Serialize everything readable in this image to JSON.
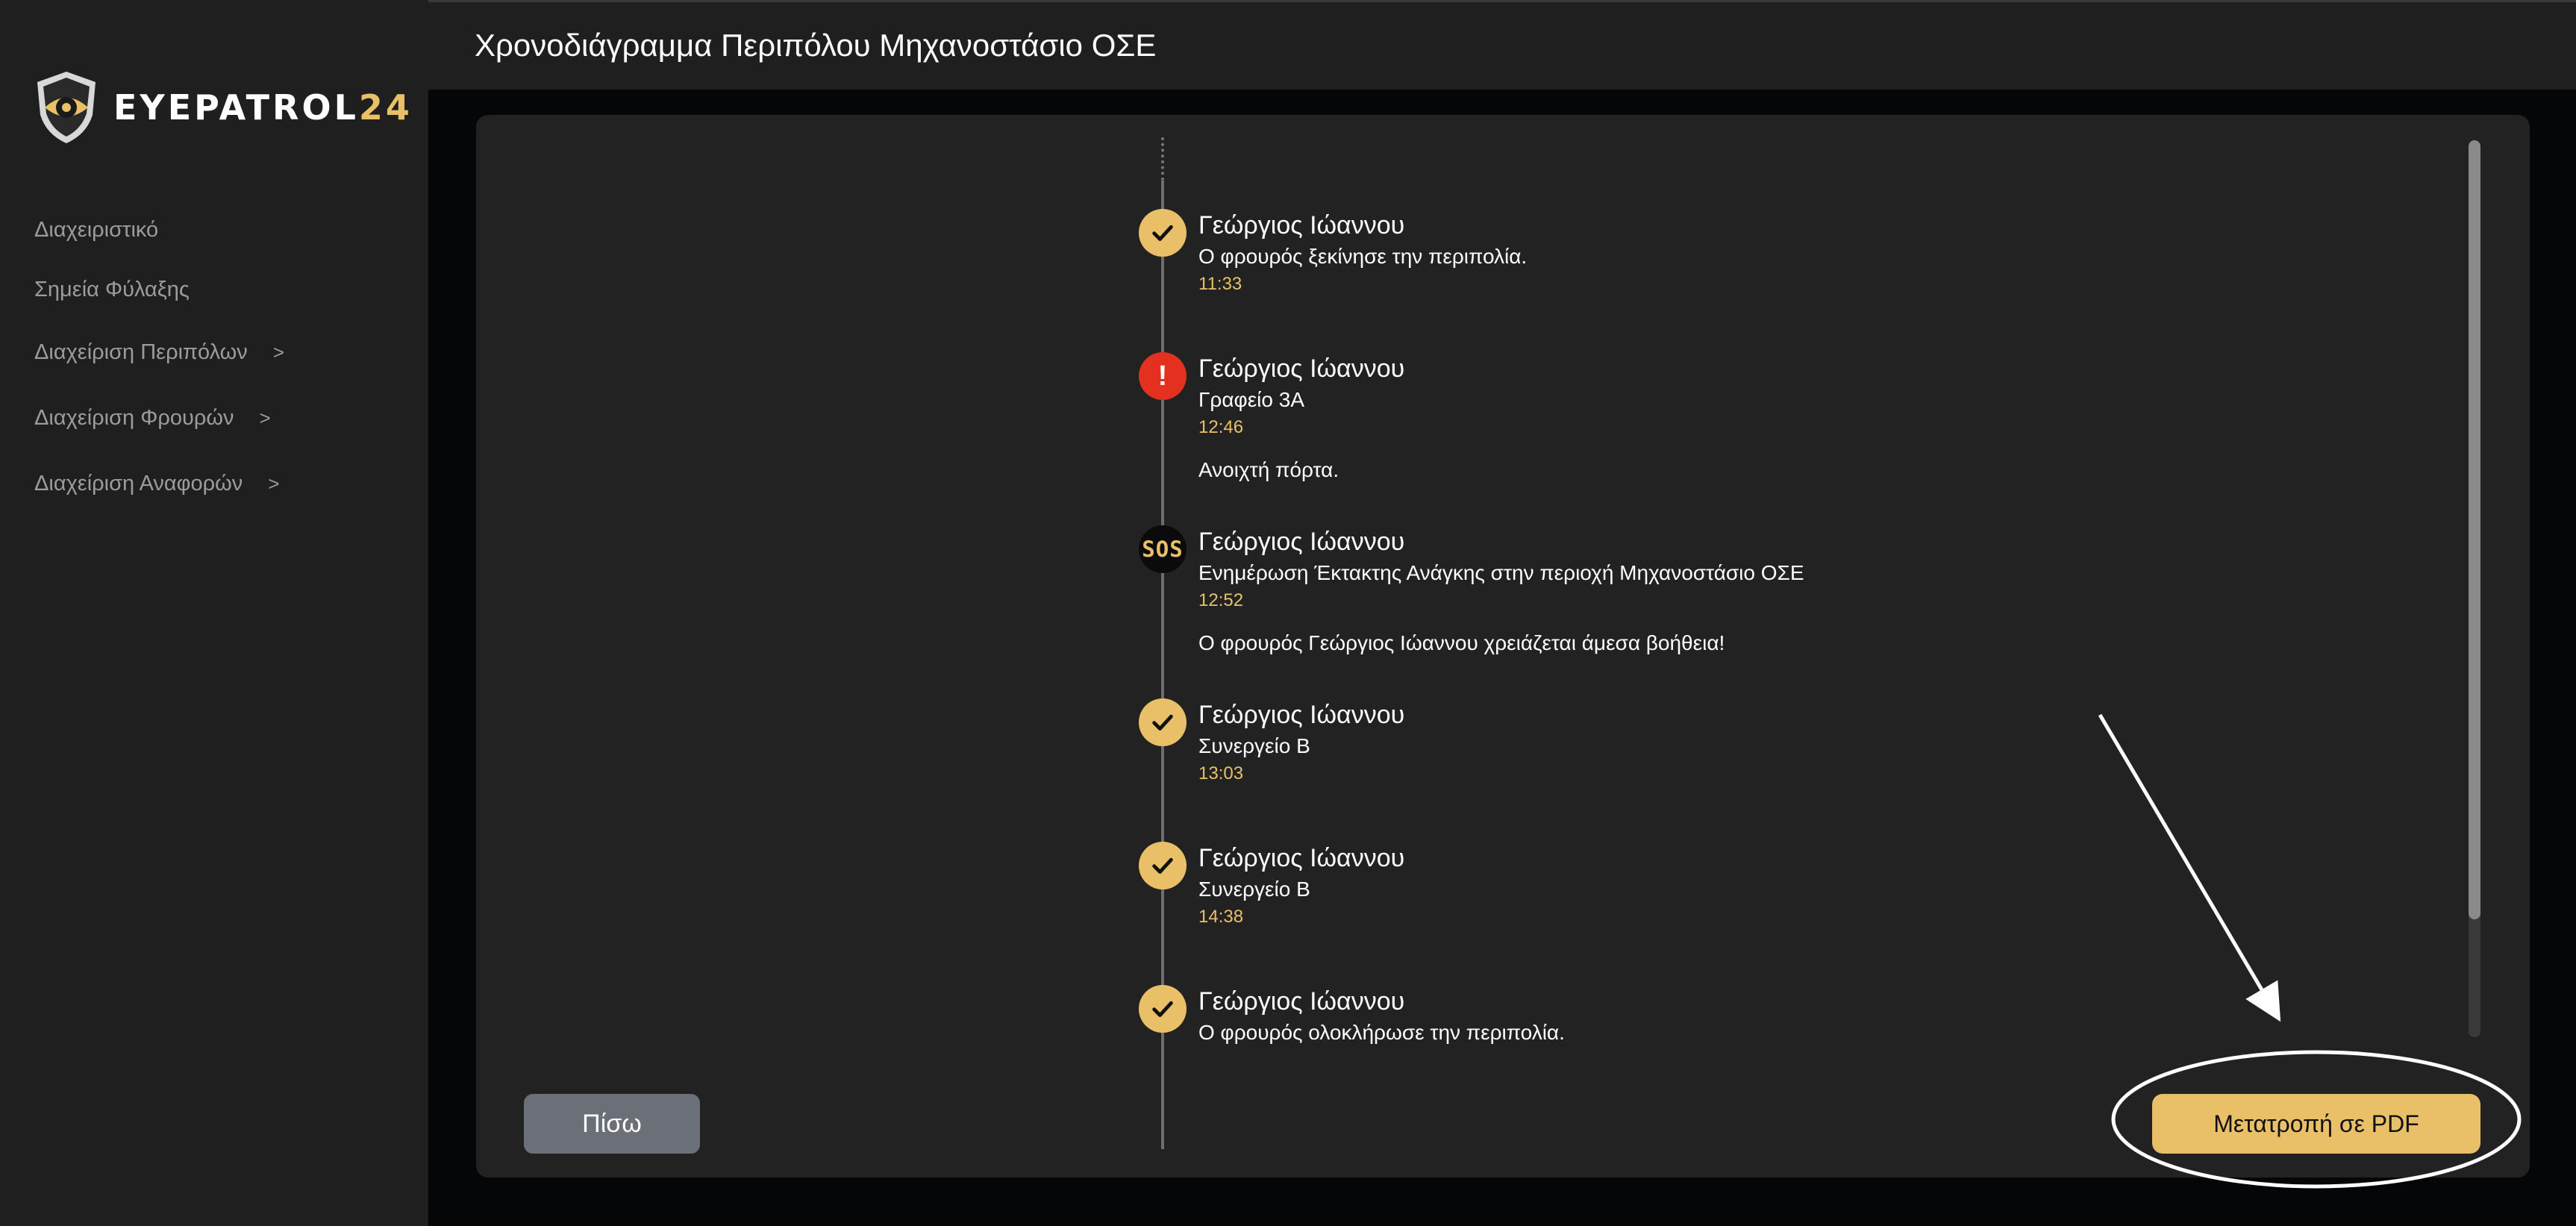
{
  "app": {
    "logo_main": "EYEPATROL",
    "logo_accent": "24"
  },
  "sidebar": {
    "items": [
      {
        "label": "Διαχειριστικό",
        "has_chevron": false
      },
      {
        "label": "Σημεία Φύλαξης",
        "has_chevron": false
      },
      {
        "label": "Διαχείριση Περιπόλων",
        "has_chevron": true
      },
      {
        "label": "Διαχείριση Φρουρών",
        "has_chevron": true
      },
      {
        "label": "Διαχείριση Αναφορών",
        "has_chevron": true
      }
    ],
    "chevron_glyph": ">"
  },
  "header": {
    "title": "Χρονοδιάγραμμα Περιπόλου Μηχανοστάσιο ΟΣΕ"
  },
  "timeline": {
    "entries": [
      {
        "type": "check",
        "name": "Γεώργιος Ιώαννου",
        "description": "Ο φρουρός ξεκίνησε την περιπολία.",
        "time": "11:33",
        "note": ""
      },
      {
        "type": "alert",
        "icon_text": "!",
        "name": "Γεώργιος Ιώαννου",
        "description": "Γραφείο 3Α",
        "time": "12:46",
        "note": "Ανοιχτή πόρτα."
      },
      {
        "type": "sos",
        "icon_text": "SOS",
        "name": "Γεώργιος Ιώαννου",
        "description": "Ενημέρωση Έκτακτης Ανάγκης στην περιοχή Μηχανοστάσιο ΟΣΕ",
        "time": "12:52",
        "note": "Ο φρουρός Γεώργιος Ιώαννου χρειάζεται άμεσα βοήθεια!"
      },
      {
        "type": "check",
        "name": "Γεώργιος Ιώαννου",
        "description": "Συνεργείο Β",
        "time": "13:03",
        "note": ""
      },
      {
        "type": "check",
        "name": "Γεώργιος Ιώαννου",
        "description": "Συνεργείο Β",
        "time": "14:38",
        "note": ""
      },
      {
        "type": "check",
        "name": "Γεώργιος Ιώαννου",
        "description": "Ο φρουρός ολοκλήρωσε την περιπολία.",
        "time": "",
        "note": ""
      }
    ]
  },
  "actions": {
    "back_label": "Πίσω",
    "pdf_label": "Μετατροπή σε PDF"
  },
  "colors": {
    "accent": "#e9c068",
    "alert": "#e3301f",
    "background": "#050607",
    "surface": "#1f1f1f",
    "panel": "#222222",
    "back_button": "#6b6f78"
  }
}
